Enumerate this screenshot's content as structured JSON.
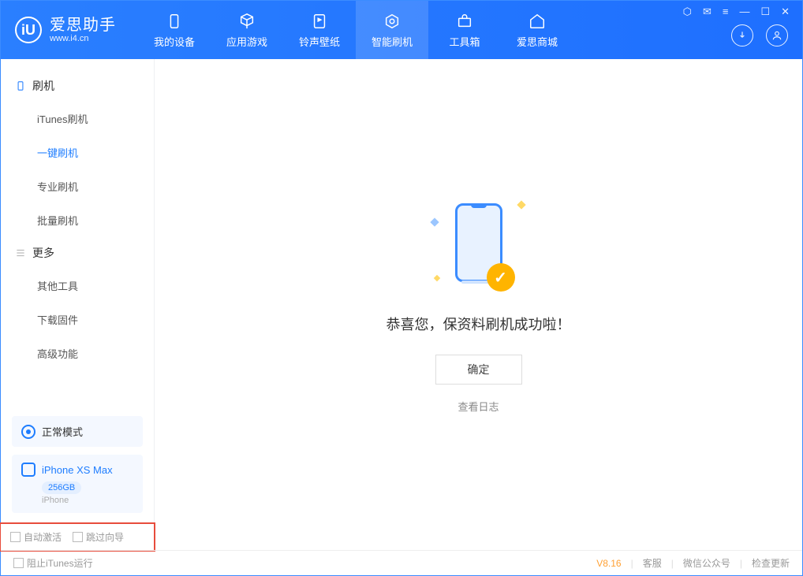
{
  "app": {
    "title": "爱思助手",
    "subtitle": "www.i4.cn",
    "logo_letter": "iU"
  },
  "nav": {
    "tabs": [
      {
        "label": "我的设备",
        "icon": "device-icon"
      },
      {
        "label": "应用游戏",
        "icon": "cube-icon"
      },
      {
        "label": "铃声壁纸",
        "icon": "music-icon"
      },
      {
        "label": "智能刷机",
        "icon": "refresh-icon",
        "active": true
      },
      {
        "label": "工具箱",
        "icon": "toolbox-icon"
      },
      {
        "label": "爱思商城",
        "icon": "home-icon"
      }
    ]
  },
  "sidebar": {
    "group1_title": "刷机",
    "group1_items": [
      {
        "label": "iTunes刷机"
      },
      {
        "label": "一键刷机",
        "active": true
      },
      {
        "label": "专业刷机"
      },
      {
        "label": "批量刷机"
      }
    ],
    "group2_title": "更多",
    "group2_items": [
      {
        "label": "其他工具"
      },
      {
        "label": "下载固件"
      },
      {
        "label": "高级功能"
      }
    ],
    "mode": "正常模式",
    "device": {
      "name": "iPhone XS Max",
      "capacity": "256GB",
      "type": "iPhone"
    },
    "checkbox1": "自动激活",
    "checkbox2": "跳过向导"
  },
  "main": {
    "success_text": "恭喜您，保资料刷机成功啦！",
    "ok_button": "确定",
    "log_link": "查看日志"
  },
  "footer": {
    "block_itunes": "阻止iTunes运行",
    "version": "V8.16",
    "link1": "客服",
    "link2": "微信公众号",
    "link3": "检查更新"
  }
}
